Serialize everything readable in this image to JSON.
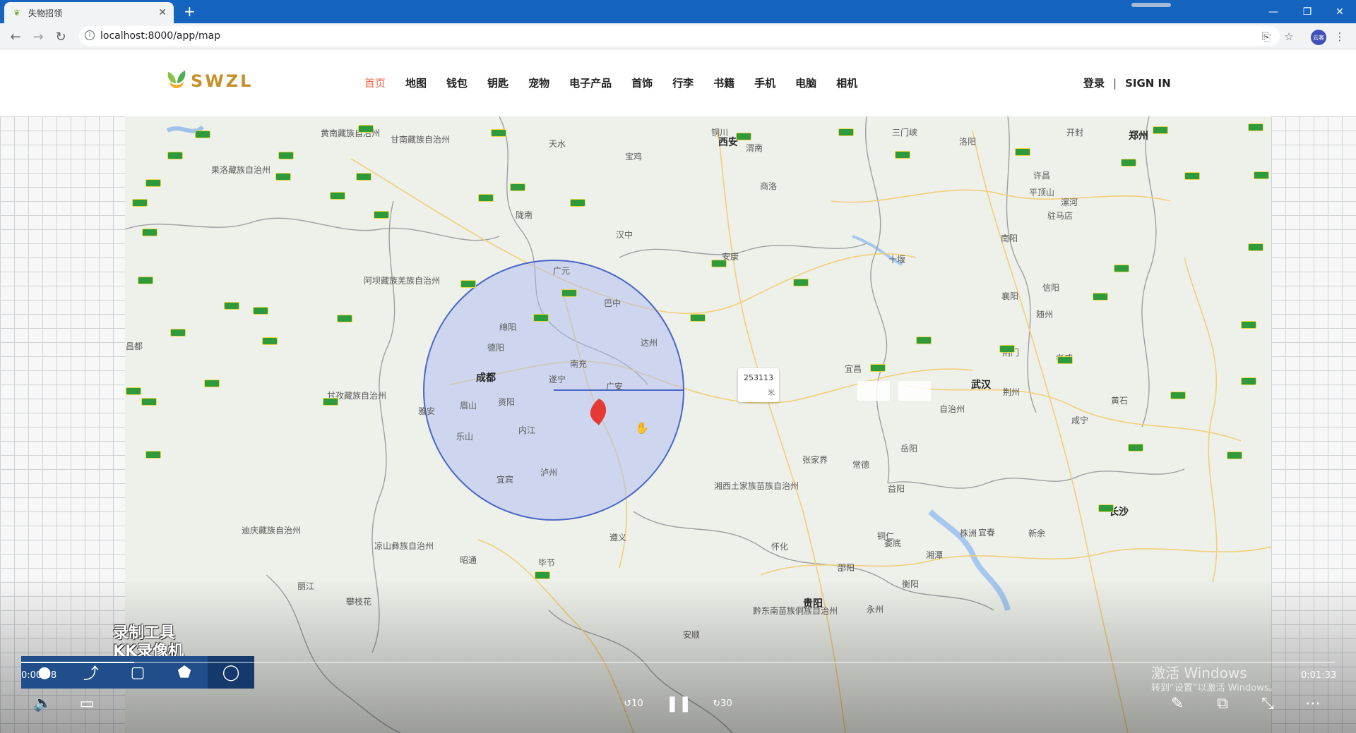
{
  "browser": {
    "tab_title": "失物招领",
    "url": "localhost:8000/app/map",
    "profile_initials": "云客"
  },
  "site": {
    "logo_text": "SWZL",
    "nav": [
      "首页",
      "地图",
      "钱包",
      "钥匙",
      "宠物",
      "电子产品",
      "首饰",
      "行李",
      "书籍",
      "手机",
      "电脑",
      "相机"
    ],
    "active_nav": "首页",
    "login_label": "登录",
    "separator": "|",
    "signin_label": "SIGN IN"
  },
  "map": {
    "tooltip_value": "253113",
    "tooltip_unit": "米",
    "cities": [
      {
        "name": "西安"
      },
      {
        "name": "成都"
      },
      {
        "name": "武汉"
      },
      {
        "name": "郑州"
      },
      {
        "name": "长沙"
      },
      {
        "name": "贵阳"
      }
    ],
    "labels": [
      "黄南藏族自治州",
      "甘南藏族自治州",
      "果洛藏族自治州",
      "天水",
      "宝鸡",
      "铜川",
      "渭南",
      "三门峡",
      "洛阳",
      "开封",
      "陇南",
      "汉中",
      "商洛",
      "平顶山",
      "许昌",
      "漯河",
      "安康",
      "南阳",
      "驻马店",
      "十堰",
      "广元",
      "阿坝藏族羌族自治州",
      "巴中",
      "绵阳",
      "德阳",
      "达州",
      "南充",
      "襄阳",
      "随州",
      "信阳",
      "遂宁",
      "广安",
      "荆门",
      "孝感",
      "宜昌",
      "甘孜藏族自治州",
      "雅安",
      "眉山",
      "资阳",
      "内江",
      "乐山",
      "荆州",
      "咸宁",
      "黄石",
      "昌都",
      "宜宾",
      "泸州",
      "张家界",
      "岳阳",
      "常德",
      "湘西土家族苗族自治州",
      "益阳",
      "遵义",
      "铜仁",
      "怀化",
      "娄底",
      "株洲",
      "宜春",
      "新余",
      "迪庆藏族自治州",
      "凉山彝族自治州",
      "昭通",
      "毕节",
      "邵阳",
      "湘潭",
      "衡阳",
      "丽江",
      "攀枝花",
      "黔东南苗族侗族自治州",
      "永州",
      "安顺",
      "自治州"
    ]
  },
  "player": {
    "elapsed": "0:00:08",
    "duration": "0:01:33",
    "progress": 0.086,
    "watermark_line1": "录制工具",
    "watermark_line2": "KK录像机",
    "windows_line1": "激活 Windows",
    "windows_line2": "转到“设置”以激活 Windows。",
    "skip_back": "10",
    "skip_forward": "30"
  },
  "colors": {
    "titlebar": "#1565c0",
    "nav_active": "#f0654c",
    "circle_fill": "#a9b9f2",
    "circle_stroke": "#4a67c8",
    "marker": "#e53935",
    "logo": "#c7902a"
  }
}
